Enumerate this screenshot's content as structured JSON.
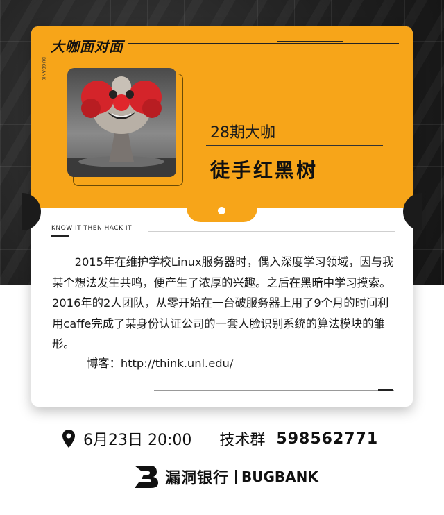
{
  "header": {
    "section_title": "大咖面对面",
    "side_label": "BUGBANK"
  },
  "guest": {
    "issue": "28期大咖",
    "name": "徒手红黑树",
    "photo_icon": "clown-mushroom-cloud-image"
  },
  "tagline": "KNOW  IT THEN  HACK  IT",
  "bio": {
    "text": "2015年在维护学校Linux服务器时，偶入深度学习领域，因与我某个想法发生共鸣，便产生了浓厚的兴趣。之后在黑暗中学习摸索。2016年的2人团队，从零开始在一台破服务器上用了9个月的时间利用caffe完成了某身份认证公司的一套人脸识别系统的算法模块的雏形。",
    "blog": "博客：http://think.unl.edu/"
  },
  "event": {
    "location_icon": "map-pin-icon",
    "datetime": "6月23日 20:00",
    "group_label": "技术群",
    "group_number": "598562771"
  },
  "logo": {
    "mark": "bugbank-b-logo",
    "cn": "漏洞银行",
    "en": "BUGBANK"
  },
  "colors": {
    "accent": "#f7a519",
    "dark": "#1b1b1b"
  }
}
